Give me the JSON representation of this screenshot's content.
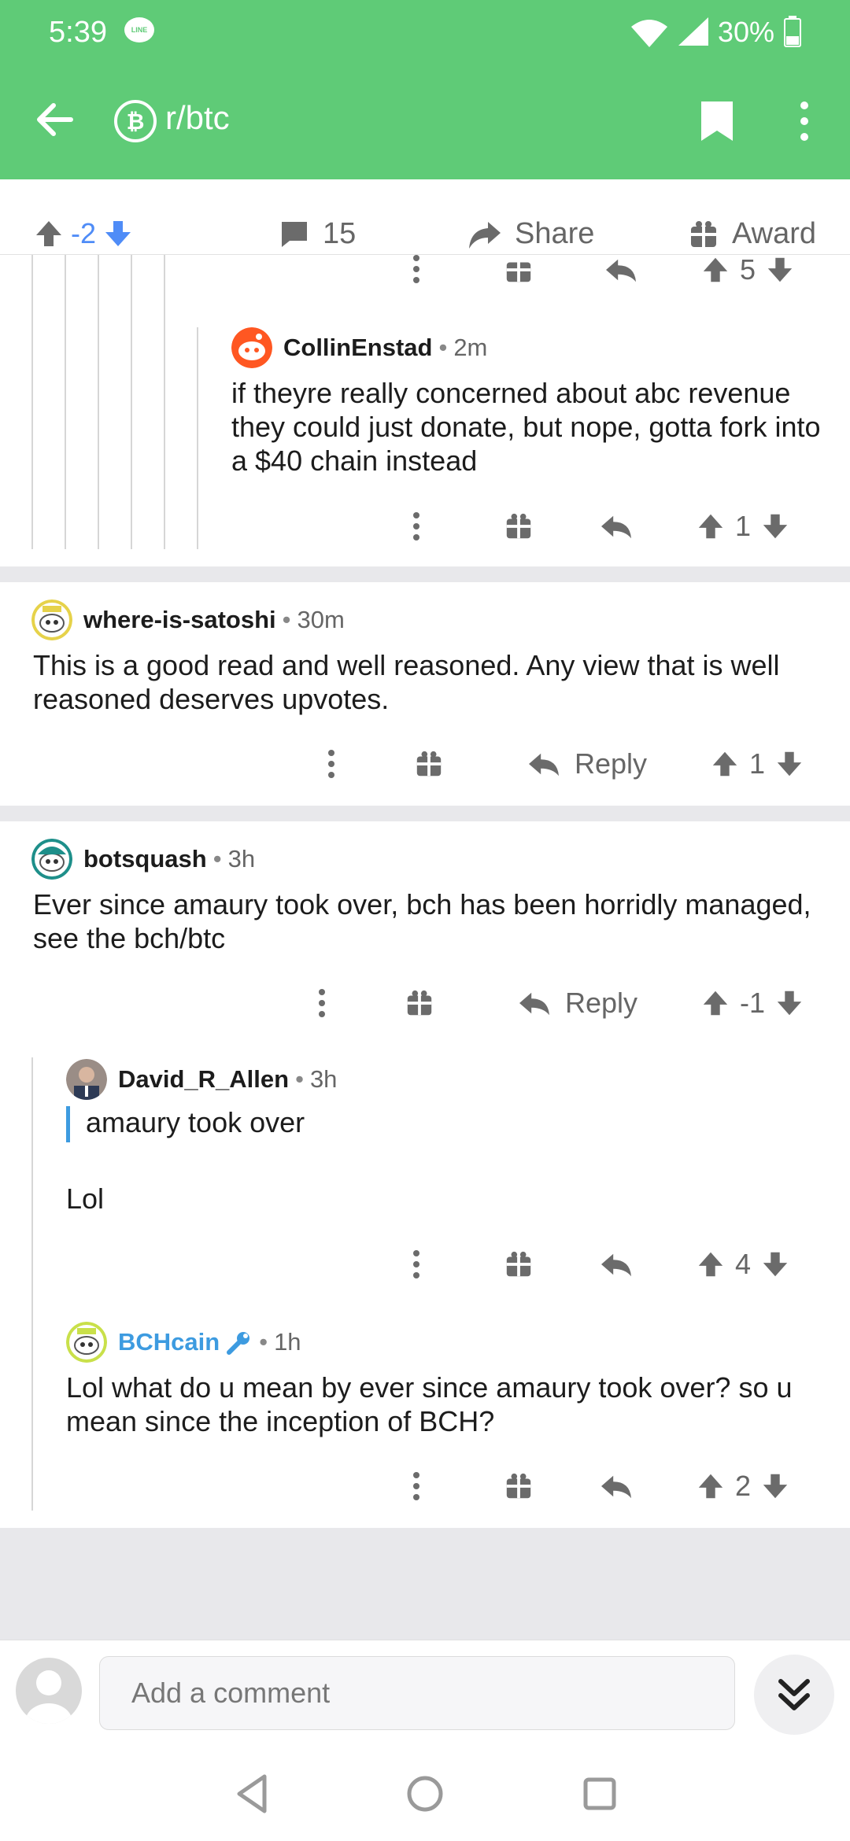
{
  "status_bar": {
    "time": "5:39",
    "notification_app": "LINE",
    "battery": "30%"
  },
  "app_bar": {
    "subreddit": "r/btc"
  },
  "post_actions": {
    "score": "-2",
    "comments": "15",
    "share_label": "Share",
    "award_label": "Award"
  },
  "comments": [
    {
      "id": "prev",
      "score": "5"
    },
    {
      "id": "collin",
      "author": "CollinEnstad",
      "age": "2m",
      "body": "if theyre really concerned about abc revenue they could just donate, but nope, gotta fork into a $40 chain instead",
      "score": "1"
    },
    {
      "id": "satoshi",
      "author": "where-is-satoshi",
      "age": "30m",
      "body": "This is a good read and well reasoned. Any view that is well reasoned deserves upvotes.",
      "reply_label": "Reply",
      "score": "1"
    },
    {
      "id": "botsquash",
      "author": "botsquash",
      "age": "3h",
      "body": "Ever since amaury took over, bch has been horridly managed, see the bch/btc",
      "reply_label": "Reply",
      "score": "-1"
    },
    {
      "id": "david",
      "author": "David_R_Allen",
      "age": "3h",
      "quote": "amaury took over",
      "body": "Lol",
      "score": "4"
    },
    {
      "id": "bchcain",
      "author": "BCHcain",
      "age": "1h",
      "body": "Lol what do u mean by ever since amaury took over? so u mean since the inception of BCH?",
      "score": "2"
    }
  ],
  "composer": {
    "placeholder": "Add a comment"
  },
  "colors": {
    "brand_green": "#5fcb77",
    "upvote_blue": "#4f8cf7",
    "mod_blue": "#3d9be0",
    "icon_grey": "#6b6b6b"
  }
}
